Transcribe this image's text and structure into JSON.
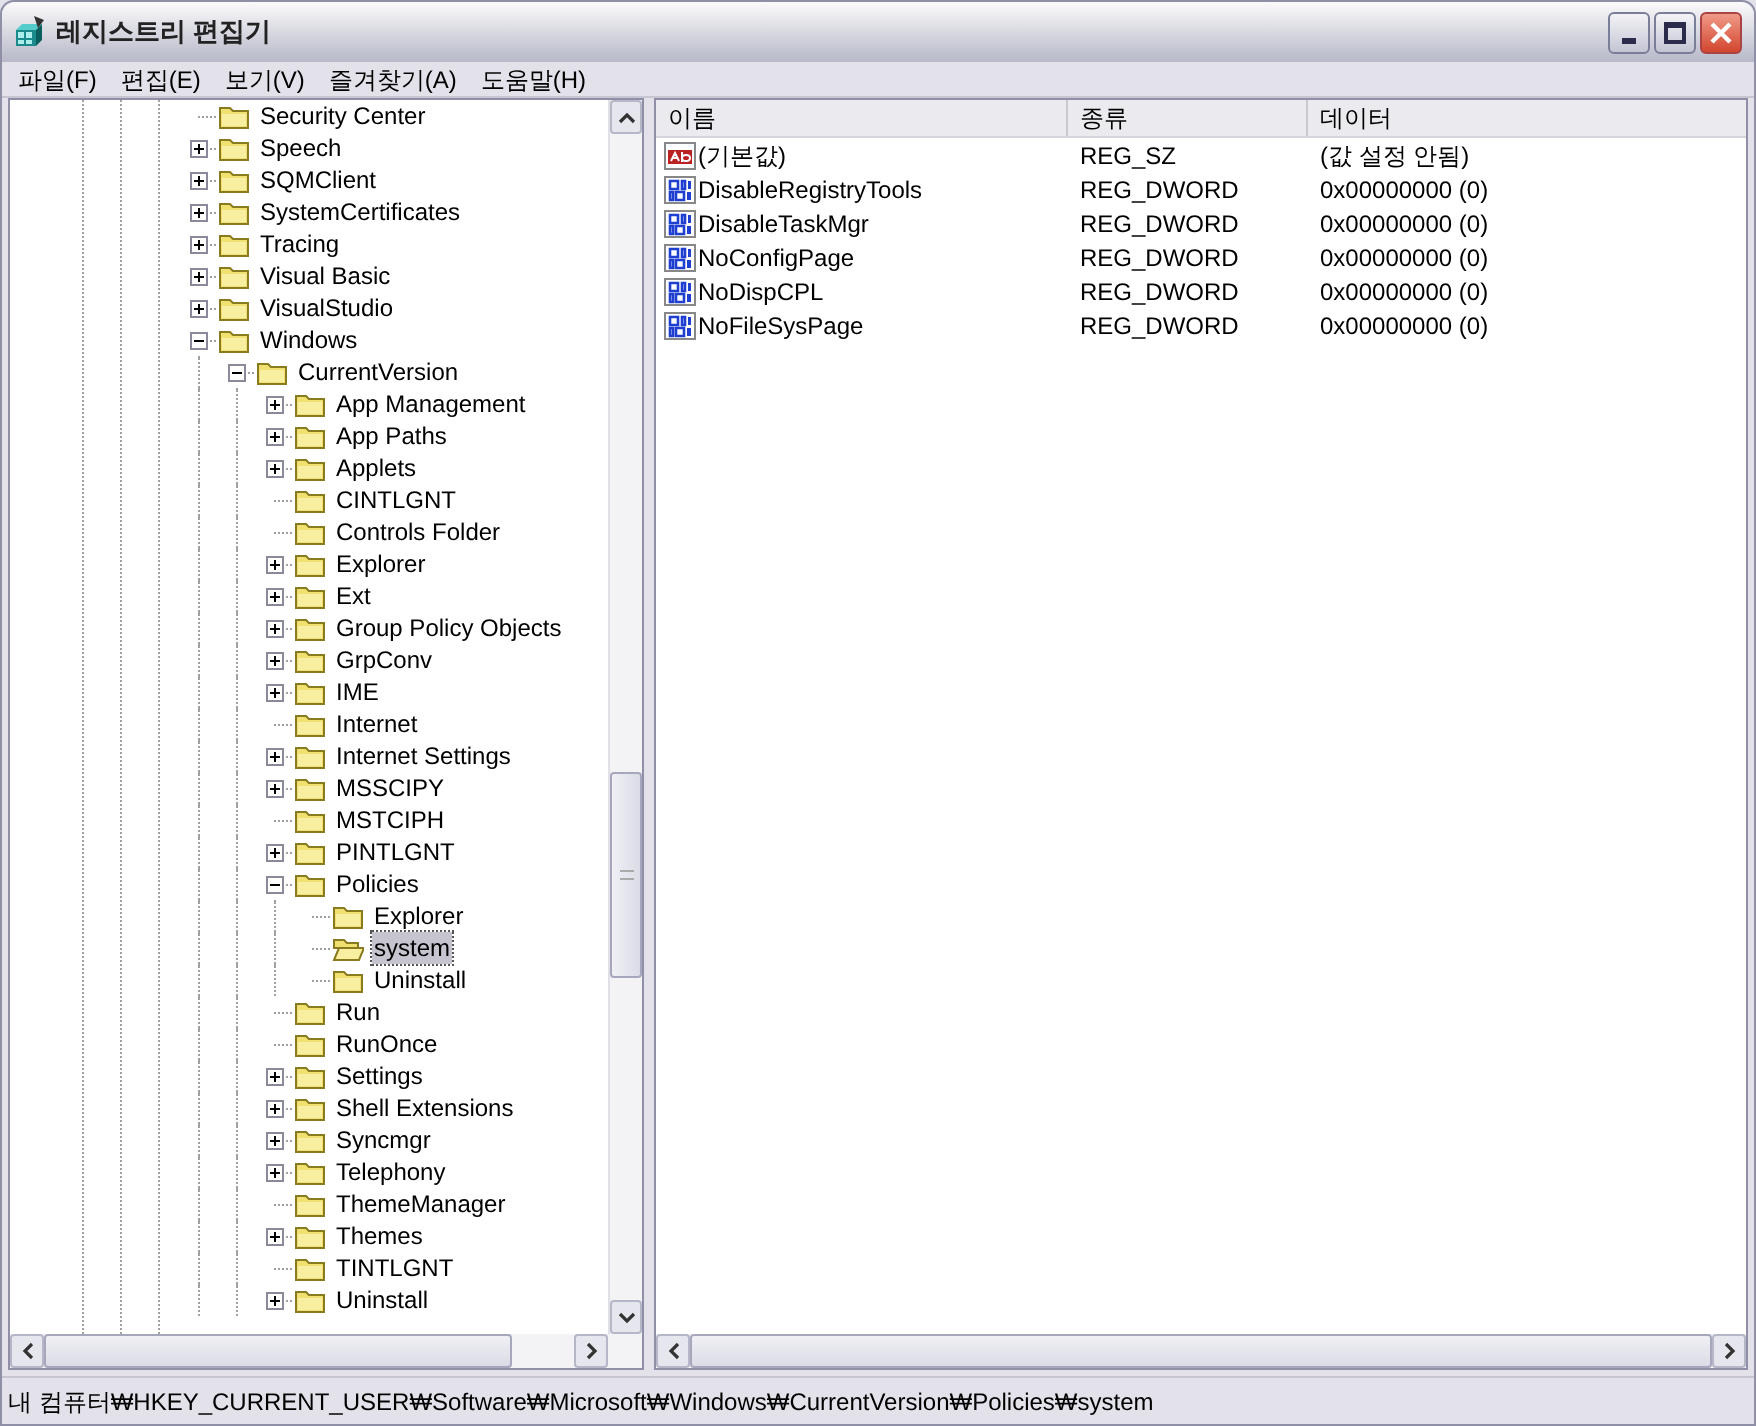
{
  "window": {
    "title": "레지스트리 편집기"
  },
  "menu": [
    {
      "label": "파일(F)"
    },
    {
      "label": "편집(E)"
    },
    {
      "label": "보기(V)"
    },
    {
      "label": "즐겨찾기(A)"
    },
    {
      "label": "도움말(H)"
    }
  ],
  "tree": [
    {
      "label": "Security Center",
      "kind": "leaf",
      "selected": false
    },
    {
      "label": "Speech",
      "kind": "collapsed",
      "selected": false
    },
    {
      "label": "SQMClient",
      "kind": "collapsed",
      "selected": false
    },
    {
      "label": "SystemCertificates",
      "kind": "collapsed",
      "selected": false
    },
    {
      "label": "Tracing",
      "kind": "collapsed",
      "selected": false
    },
    {
      "label": "Visual Basic",
      "kind": "collapsed",
      "selected": false
    },
    {
      "label": "VisualStudio",
      "kind": "collapsed",
      "selected": false
    },
    {
      "label": "Windows",
      "kind": "expanded",
      "selected": false,
      "children": [
        {
          "label": "CurrentVersion",
          "kind": "expanded",
          "selected": false,
          "children": [
            {
              "label": "App Management",
              "kind": "collapsed",
              "selected": false
            },
            {
              "label": "App Paths",
              "kind": "collapsed",
              "selected": false
            },
            {
              "label": "Applets",
              "kind": "collapsed",
              "selected": false
            },
            {
              "label": "CINTLGNT",
              "kind": "leaf",
              "selected": false
            },
            {
              "label": "Controls Folder",
              "kind": "leaf",
              "selected": false
            },
            {
              "label": "Explorer",
              "kind": "collapsed",
              "selected": false
            },
            {
              "label": "Ext",
              "kind": "collapsed",
              "selected": false
            },
            {
              "label": "Group Policy Objects",
              "kind": "collapsed",
              "selected": false
            },
            {
              "label": "GrpConv",
              "kind": "collapsed",
              "selected": false
            },
            {
              "label": "IME",
              "kind": "collapsed",
              "selected": false
            },
            {
              "label": "Internet",
              "kind": "leaf",
              "selected": false
            },
            {
              "label": "Internet Settings",
              "kind": "collapsed",
              "selected": false
            },
            {
              "label": "MSSCIPY",
              "kind": "collapsed",
              "selected": false
            },
            {
              "label": "MSTCIPH",
              "kind": "leaf",
              "selected": false
            },
            {
              "label": "PINTLGNT",
              "kind": "collapsed",
              "selected": false
            },
            {
              "label": "Policies",
              "kind": "expanded",
              "selected": false,
              "children": [
                {
                  "label": "Explorer",
                  "kind": "leaf",
                  "selected": false
                },
                {
                  "label": "system",
                  "kind": "leaf",
                  "selected": true
                },
                {
                  "label": "Uninstall",
                  "kind": "leaf",
                  "selected": false
                }
              ]
            },
            {
              "label": "Run",
              "kind": "leaf",
              "selected": false
            },
            {
              "label": "RunOnce",
              "kind": "leaf",
              "selected": false
            },
            {
              "label": "Settings",
              "kind": "collapsed",
              "selected": false
            },
            {
              "label": "Shell Extensions",
              "kind": "collapsed",
              "selected": false
            },
            {
              "label": "Syncmgr",
              "kind": "collapsed",
              "selected": false
            },
            {
              "label": "Telephony",
              "kind": "collapsed",
              "selected": false
            },
            {
              "label": "ThemeManager",
              "kind": "leaf",
              "selected": false
            },
            {
              "label": "Themes",
              "kind": "collapsed",
              "selected": false
            },
            {
              "label": "TINTLGNT",
              "kind": "leaf",
              "selected": false
            },
            {
              "label": "Uninstall",
              "kind": "collapsed",
              "selected": false
            }
          ]
        }
      ]
    }
  ],
  "values": {
    "columns": [
      "이름",
      "종류",
      "데이터"
    ],
    "rows": [
      {
        "kind": "string",
        "name": "(기본값)",
        "type": "REG_SZ",
        "data": "(값 설정 안됨)"
      },
      {
        "kind": "dword",
        "name": "DisableRegistryTools",
        "type": "REG_DWORD",
        "data": "0x00000000 (0)"
      },
      {
        "kind": "dword",
        "name": "DisableTaskMgr",
        "type": "REG_DWORD",
        "data": "0x00000000 (0)"
      },
      {
        "kind": "dword",
        "name": "NoConfigPage",
        "type": "REG_DWORD",
        "data": "0x00000000 (0)"
      },
      {
        "kind": "dword",
        "name": "NoDispCPL",
        "type": "REG_DWORD",
        "data": "0x00000000 (0)"
      },
      {
        "kind": "dword",
        "name": "NoFileSysPage",
        "type": "REG_DWORD",
        "data": "0x00000000 (0)"
      }
    ]
  },
  "status_bar": "내 컴퓨터₩HKEY_CURRENT_USER₩Software₩Microsoft₩Windows₩CurrentVersion₩Policies₩system"
}
